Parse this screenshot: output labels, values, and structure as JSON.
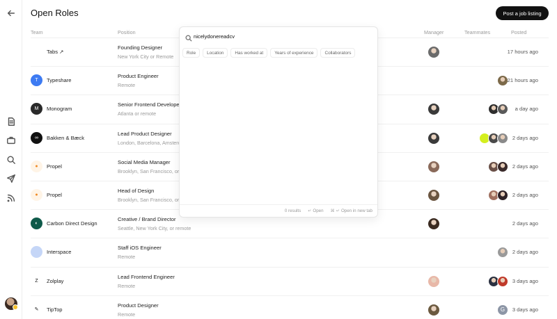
{
  "header": {
    "title": "Open Roles",
    "post_button": "Post a job listing"
  },
  "columns": {
    "team": "Team",
    "position": "Position",
    "manager": "Manager",
    "teammates": "Teammates",
    "posted": "Posted"
  },
  "search": {
    "value": "nicelydonereadcv",
    "filters": [
      "Role",
      "Location",
      "Has worked at",
      "Years of experience",
      "Collaborators"
    ],
    "results": "0 results",
    "open_label": "Open",
    "open_new_tab_label": "Open in new tab",
    "enter_symbol": "↵",
    "cmd_symbol": "⌘"
  },
  "rows": [
    {
      "company": "Tabs ↗",
      "title": "Founding Designer",
      "location": "New York City or Remote",
      "posted": "17 hours ago",
      "logo_color": "#ffffff",
      "logo_text": "",
      "manager_color": "#6b6b6b",
      "mates": []
    },
    {
      "company": "Typeshare",
      "title": "Product Engineer",
      "location": "Remote",
      "posted": "21 hours ago",
      "logo_color": "#3d7bf2",
      "logo_text": "T",
      "manager_color": "",
      "mates": [
        "#7c6a4a"
      ]
    },
    {
      "company": "Monogram",
      "title": "Senior Frontend Developer",
      "location": "Atlanta or remote",
      "posted": "a day ago",
      "logo_color": "#2a2a2a",
      "logo_text": "M",
      "manager_color": "#3a3a3a",
      "mates": [
        "#2e2e2e",
        "#5a5a5a"
      ]
    },
    {
      "company": "Bakken & Bæck",
      "title": "Lead Product Designer",
      "location": "London, Barcelona, Amsterdam",
      "posted": "2 days ago",
      "logo_color": "#111111",
      "logo_text": "∞",
      "manager_color": "#3b3b3b",
      "mates": [
        "#d4ef1f",
        "#4a4a4a",
        "#8a8a8a"
      ]
    },
    {
      "company": "Propel",
      "title": "Social Media Manager",
      "location": "Brooklyn, San Francisco, or Remote",
      "posted": "2 days ago",
      "logo_color": "#fff4e6",
      "logo_text": "●",
      "manager_color": "#8a6a5a",
      "mates": [
        "#6a5048",
        "#3a2a2a"
      ]
    },
    {
      "company": "Propel",
      "title": "Head of Design",
      "location": "Brooklyn, San Francisco, or Remote",
      "posted": "2 days ago",
      "logo_color": "#fff4e6",
      "logo_text": "●",
      "manager_color": "#6a5540",
      "mates": [
        "#a07060",
        "#2e2226"
      ]
    },
    {
      "company": "Carbon Direct Design",
      "title": "Creative / Brand Director",
      "location": "Seattle, New York City, or remote",
      "posted": "2 days ago",
      "logo_color": "#0f5a4a",
      "logo_text": "◐",
      "manager_color": "#3a2a20",
      "mates": []
    },
    {
      "company": "Interspace",
      "title": "Staff iOS Engineer",
      "location": "Remote",
      "posted": "2 days ago",
      "logo_color": "#c5d6f7",
      "logo_text": "",
      "manager_color": "",
      "mates": [
        "#9a9a9a"
      ]
    },
    {
      "company": "Zolplay",
      "title": "Lead Frontend Engineer",
      "location": "Remote",
      "posted": "3 days ago",
      "logo_color": "#ffffff",
      "logo_text": "Z",
      "manager_color": "#e8b8a8",
      "mates": [
        "#2a3040",
        "#c03a2a"
      ]
    },
    {
      "company": "TipTop",
      "title": "Product Designer",
      "location": "Remote",
      "posted": "3 days ago",
      "logo_color": "#ffffff",
      "logo_text": "✎",
      "manager_color": "#6b5a40",
      "mates": [
        "#8d96a6"
      ],
      "mate_letter": "G"
    }
  ]
}
